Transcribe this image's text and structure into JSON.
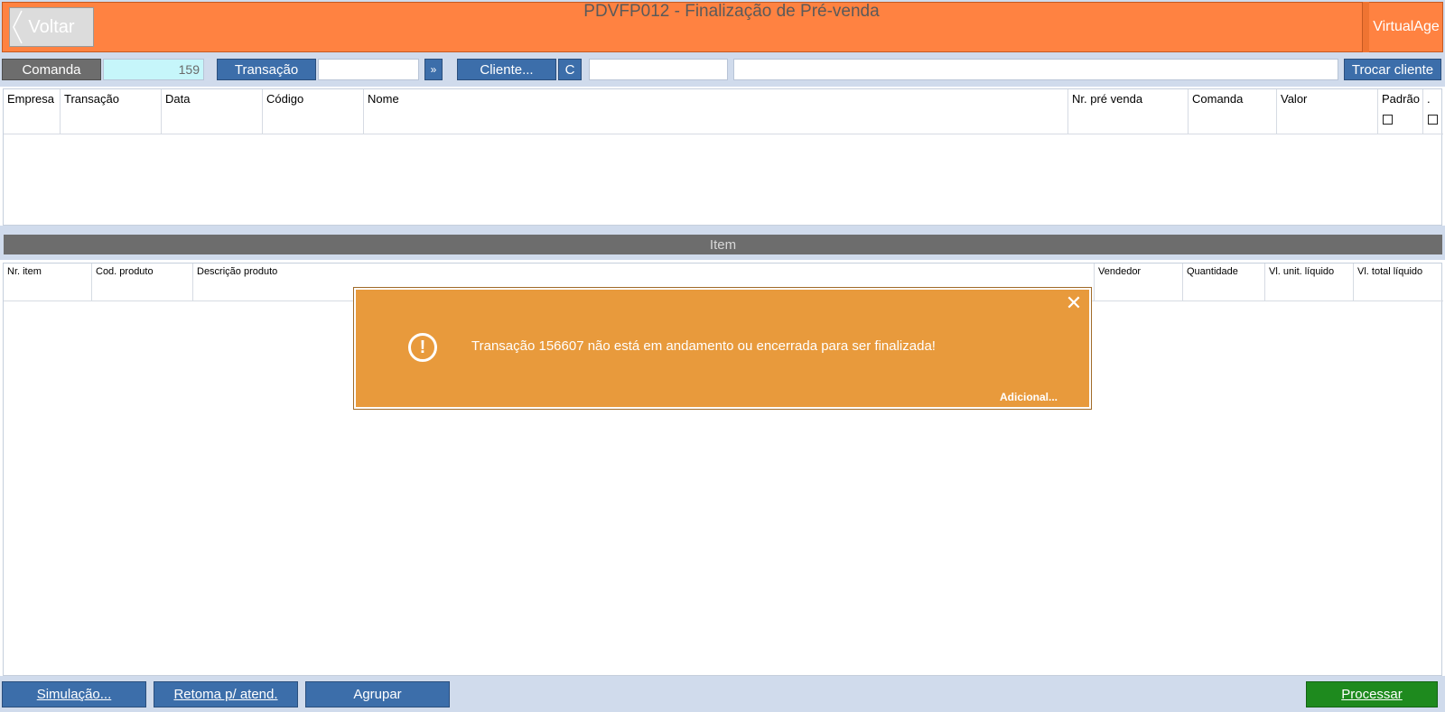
{
  "header": {
    "back_label": "Voltar",
    "title": "PDVFP012 - Finalização de Pré-venda",
    "brand": "VirtualAge"
  },
  "toolbar": {
    "comanda_label": "Comanda",
    "comanda_value": "159",
    "transacao_label": "Transação",
    "transacao_value": "",
    "arrow_label": "»",
    "cliente_label": "Cliente...",
    "c_label": "C",
    "cliente_code": "",
    "cliente_name": "",
    "trocar_label": "Trocar cliente"
  },
  "grid1": {
    "columns": [
      "Empresa",
      "Transação",
      "Data",
      "Código",
      "Nome",
      "Nr. pré venda",
      "Comanda",
      "Valor",
      "Padrão",
      "."
    ]
  },
  "item_section": {
    "title": "Item"
  },
  "grid2": {
    "columns": [
      "Nr. item",
      "Cod. produto",
      "Descrição produto",
      "Vendedor",
      "Quantidade",
      "Vl. unit. líquido",
      "Vl. total líquido"
    ]
  },
  "footer": {
    "simulacao_label": "Simulação...",
    "retoma_label": "Retoma p/ atend.",
    "agrupar_label": "Agrupar",
    "processar_label": "Processar"
  },
  "dialog": {
    "message": "Transação 156607 não está em andamento ou encerrada para ser finalizada!",
    "more_label": "Adicional...",
    "icon": "exclamation-circle-icon",
    "close_icon": "close-icon"
  },
  "colors": {
    "header": "#ff8241",
    "dialog": "#e89a3c",
    "blue_button": "#3c6eaa",
    "gray_button": "#6d6d6d",
    "process_button": "#1e8a1e"
  }
}
